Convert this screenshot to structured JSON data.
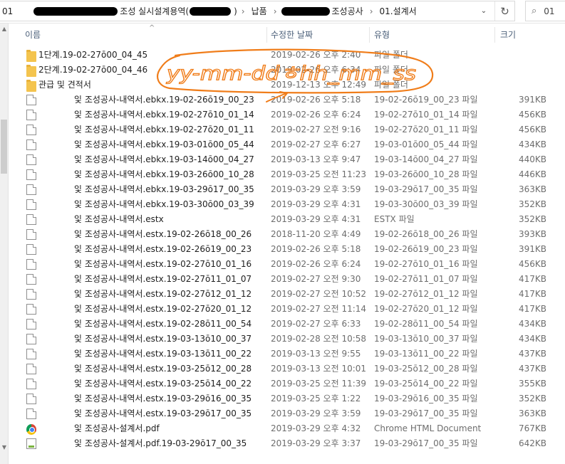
{
  "address_bar": {
    "crumbs": [
      {
        "text": "01",
        "redact_after": 120
      },
      {
        "text": "조성 실시설계용역(",
        "redact_after": 58
      },
      {
        "text": "납품",
        "redact_after": 0
      },
      {
        "text": "",
        "redact_before": 68,
        "text_after": "조성공사"
      },
      {
        "text": "01.설계서",
        "redact_after": 0
      }
    ],
    "dropdown_icon": "chevron-down-icon",
    "refresh_icon": "refresh-icon",
    "search_placeholder": "01"
  },
  "columns": {
    "name": "이름",
    "date": "수정한 날짜",
    "type": "유형",
    "size": "크기"
  },
  "annotation": {
    "text": "yy-mm-ddㅎhh_mm_ss",
    "color": "#f07d1a"
  },
  "rows": [
    {
      "kind": "folder",
      "icon": "folder-icon",
      "name": "1단계.19-02-27ō00_04_45",
      "date": "2019-02-26 오후 2:40",
      "type": "파일 폴더",
      "size": ""
    },
    {
      "kind": "folder",
      "icon": "folder-icon",
      "name": "2단계.19-02-27ō00_04_46",
      "date": "2019-02-26 오후 6:34",
      "type": "파일 폴더",
      "size": ""
    },
    {
      "kind": "folder",
      "icon": "folder-icon",
      "name": "관급 및 견적서",
      "date": "2019-12-13 오후 12:49",
      "type": "파일 폴더",
      "size": ""
    },
    {
      "kind": "file",
      "icon": "file-icon",
      "name": "잋 조성공사-내역서.ebkx.19-02-26ō19_00_23",
      "date": "2019-02-26 오후 5:18",
      "type": "19-02-26ō19_00_23 파일",
      "size": "391KB"
    },
    {
      "kind": "file",
      "icon": "file-icon",
      "name": "잋 조성공사-내역서.ebkx.19-02-27ō10_01_14",
      "date": "2019-02-26 오후 6:24",
      "type": "19-02-27ō10_01_14 파일",
      "size": "456KB"
    },
    {
      "kind": "file",
      "icon": "file-icon",
      "name": "잋 조성공사-내역서.ebkx.19-02-27ō20_01_11",
      "date": "2019-02-27 오전 9:16",
      "type": "19-02-27ō20_01_11 파일",
      "size": "456KB"
    },
    {
      "kind": "file",
      "icon": "file-icon",
      "name": "잋 조성공사-내역서.ebkx.19-03-01ō00_05_44",
      "date": "2019-02-27 오후 6:27",
      "type": "19-03-01ō00_05_44 파일",
      "size": "434KB"
    },
    {
      "kind": "file",
      "icon": "file-icon",
      "name": "잋 조성공사-내역서.ebkx.19-03-14ō00_04_27",
      "date": "2019-03-13 오후 9:47",
      "type": "19-03-14ō00_04_27 파일",
      "size": "440KB"
    },
    {
      "kind": "file",
      "icon": "file-icon",
      "name": "잋 조성공사-내역서.ebkx.19-03-26ō00_10_28",
      "date": "2019-03-25 오전 11:23",
      "type": "19-03-26ō00_10_28 파일",
      "size": "446KB"
    },
    {
      "kind": "file",
      "icon": "file-icon",
      "name": "잋 조성공사-내역서.ebkx.19-03-29ō17_00_35",
      "date": "2019-03-29 오후 3:59",
      "type": "19-03-29ō17_00_35 파일",
      "size": "363KB"
    },
    {
      "kind": "file",
      "icon": "file-icon",
      "name": "잋 조성공사-내역서.ebkx.19-03-30ō00_03_39",
      "date": "2019-03-29 오후 4:31",
      "type": "19-03-30ō00_03_39 파일",
      "size": "352KB"
    },
    {
      "kind": "file",
      "icon": "file-icon",
      "name": "잋 조성공사-내역서.estx",
      "date": "2019-03-29 오후 4:31",
      "type": "ESTX 파일",
      "size": "352KB"
    },
    {
      "kind": "file",
      "icon": "file-icon",
      "name": "잋 조성공사-내역서.estx.19-02-26ō18_00_26",
      "date": "2018-11-20 오후 4:49",
      "type": "19-02-26ō18_00_26 파일",
      "size": "393KB"
    },
    {
      "kind": "file",
      "icon": "file-icon",
      "name": "잋 조성공사-내역서.estx.19-02-26ō19_00_23",
      "date": "2019-02-26 오후 5:18",
      "type": "19-02-26ō19_00_23 파일",
      "size": "391KB"
    },
    {
      "kind": "file",
      "icon": "file-icon",
      "name": "잋 조성공사-내역서.estx.19-02-27ō10_01_16",
      "date": "2019-02-26 오후 6:24",
      "type": "19-02-27ō10_01_16 파일",
      "size": "456KB"
    },
    {
      "kind": "file",
      "icon": "file-icon",
      "name": "잋 조성공사-내역서.estx.19-02-27ō11_01_07",
      "date": "2019-02-27 오전 9:30",
      "type": "19-02-27ō11_01_07 파일",
      "size": "417KB"
    },
    {
      "kind": "file",
      "icon": "file-icon",
      "name": "잋 조성공사-내역서.estx.19-02-27ō12_01_12",
      "date": "2019-02-27 오전 10:52",
      "type": "19-02-27ō12_01_12 파일",
      "size": "417KB"
    },
    {
      "kind": "file",
      "icon": "file-icon",
      "name": "잋 조성공사-내역서.estx.19-02-27ō20_01_12",
      "date": "2019-02-27 오전 11:14",
      "type": "19-02-27ō20_01_12 파일",
      "size": "417KB"
    },
    {
      "kind": "file",
      "icon": "file-icon",
      "name": "잋 조성공사-내역서.estx.19-02-28ō11_00_54",
      "date": "2019-02-27 오후 6:33",
      "type": "19-02-28ō11_00_54 파일",
      "size": "434KB"
    },
    {
      "kind": "file",
      "icon": "file-icon",
      "name": "잋 조성공사-내역서.estx.19-03-13ō10_00_37",
      "date": "2019-02-28 오전 10:58",
      "type": "19-03-13ō10_00_37 파일",
      "size": "434KB"
    },
    {
      "kind": "file",
      "icon": "file-icon",
      "name": "잋 조성공사-내역서.estx.19-03-13ō11_00_22",
      "date": "2019-03-13 오전 9:55",
      "type": "19-03-13ō11_00_22 파일",
      "size": "437KB"
    },
    {
      "kind": "file",
      "icon": "file-icon",
      "name": "잋 조성공사-내역서.estx.19-03-25ō12_00_28",
      "date": "2019-03-13 오전 10:01",
      "type": "19-03-25ō12_00_28 파일",
      "size": "437KB"
    },
    {
      "kind": "file",
      "icon": "file-icon",
      "name": "잋 조성공사-내역서.estx.19-03-25ō14_00_22",
      "date": "2019-03-25 오전 11:39",
      "type": "19-03-25ō14_00_22 파일",
      "size": "355KB"
    },
    {
      "kind": "file",
      "icon": "file-icon",
      "name": "잋 조성공사-내역서.estx.19-03-29ō16_00_35",
      "date": "2019-03-25 오후 1:22",
      "type": "19-03-29ō16_00_35 파일",
      "size": "352KB"
    },
    {
      "kind": "file",
      "icon": "file-icon",
      "name": "잋 조성공사-내역서.estx.19-03-29ō17_00_35",
      "date": "2019-03-29 오후 3:59",
      "type": "19-03-29ō17_00_35 파일",
      "size": "363KB"
    },
    {
      "kind": "chrome",
      "icon": "chrome-icon",
      "name": "잋 조성공사-설계서.pdf",
      "date": "2019-03-29 오후 4:32",
      "type": "Chrome HTML Document",
      "size": "767KB"
    },
    {
      "kind": "pdf",
      "icon": "pdf-file-icon",
      "name": "잋 조성공사-설계서.pdf.19-03-29ō17_00_35",
      "date": "2019-03-29 오후 3:37",
      "type": "19-03-29ō17_00_35 파일",
      "size": "642KB"
    }
  ]
}
